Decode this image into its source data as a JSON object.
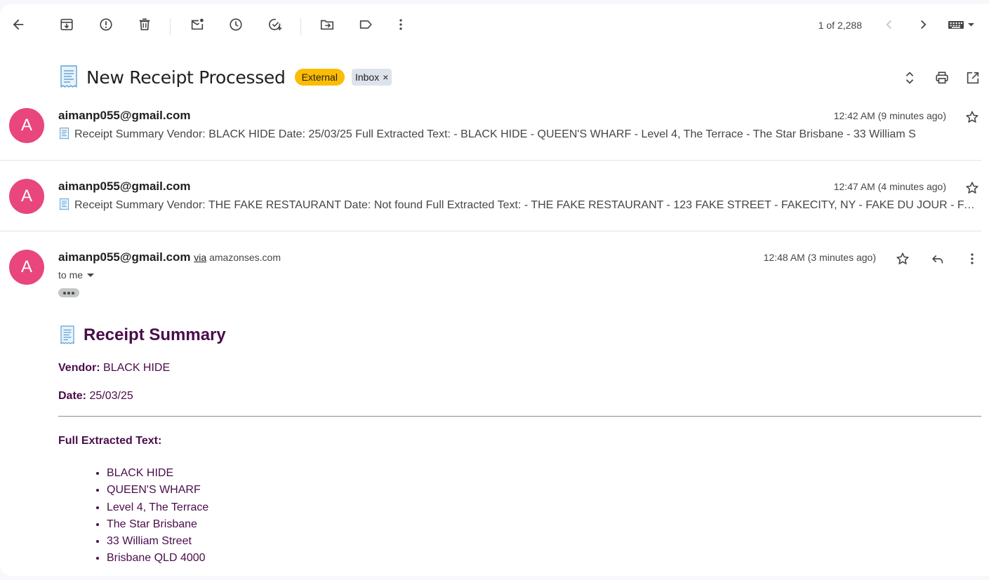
{
  "toolbar": {
    "counter": "1 of 2,288",
    "icons": [
      "back-arrow-icon",
      "archive-icon",
      "report-spam-icon",
      "delete-icon",
      "mark-unread-icon",
      "snooze-icon",
      "add-to-tasks-icon",
      "move-to-icon",
      "label-icon",
      "more-vert-icon",
      "newer-chevron-icon",
      "older-chevron-icon",
      "keyboard-icon"
    ]
  },
  "thread": {
    "emoji": "🧾",
    "subject": "New Receipt Processed",
    "labels": {
      "external": "External",
      "inbox": "Inbox",
      "inbox_remove": "×"
    }
  },
  "messages": [
    {
      "avatar_letter": "A",
      "sender": "aimanp055@gmail.com",
      "time": "12:42 AM (9 minutes ago)",
      "snippet": "Receipt Summary Vendor: BLACK HIDE Date: 25/03/25 Full Extracted Text: - BLACK HIDE - QUEEN'S WHARF - Level 4, The Terrace - The Star Brisbane - 33 William S"
    },
    {
      "avatar_letter": "A",
      "sender": "aimanp055@gmail.com",
      "time": "12:47 AM (4 minutes ago)",
      "snippet": "Receipt Summary Vendor: THE FAKE RESTAURANT Date: Not found Full Extracted Text: - THE FAKE RESTAURANT - 123 FAKE STREET - FAKECITY, NY - FAKE DU JOUR - FAKE"
    }
  ],
  "open_message": {
    "avatar_letter": "A",
    "sender": "aimanp055@gmail.com",
    "via_word": "via",
    "via_domain": "amazonses.com",
    "time": "12:48 AM (3 minutes ago)",
    "to": "to me",
    "body": {
      "heading": "Receipt Summary",
      "vendor_label": "Vendor:",
      "vendor": "BLACK HIDE",
      "date_label": "Date:",
      "date": "25/03/25",
      "full_text_label": "Full Extracted Text:",
      "lines": [
        "BLACK HIDE",
        "QUEEN'S WHARF",
        "Level 4, The Terrace",
        "The Star Brisbane",
        "33 William Street",
        "Brisbane QLD 4000"
      ]
    }
  },
  "colors": {
    "avatar": "#e8467c",
    "external_label": "#fbbc04",
    "inbox_label": "#dde3ea",
    "body_text": "#4a0d4a"
  }
}
